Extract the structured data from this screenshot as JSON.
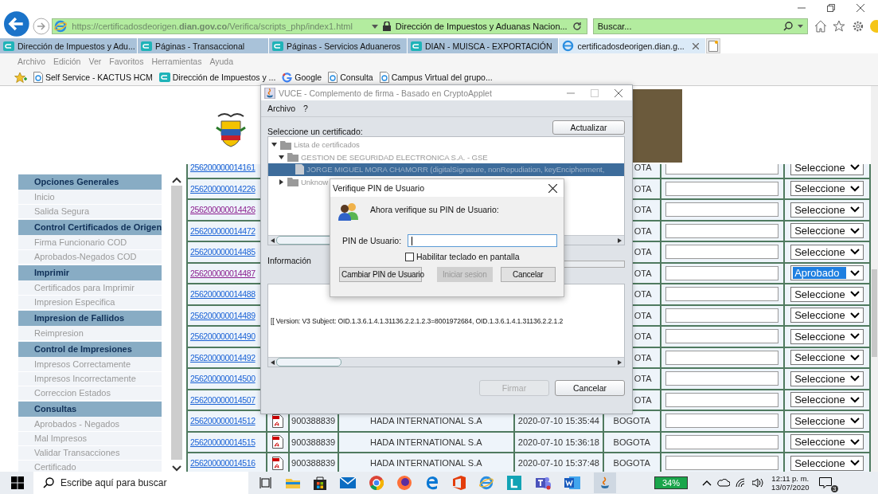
{
  "browser": {
    "url": "https://certificadosdeorigen.**dian.gov.co**/Verifica/scripts_php/index1.html",
    "site_title": "Dirección de Impuestos y Aduanas Nacion...",
    "search_placeholder": "Buscar...",
    "tabs": [
      {
        "label": "Dirección de Impuestos y Adu...",
        "selected": false
      },
      {
        "label": "Páginas - Transaccional",
        "selected": false
      },
      {
        "label": "Páginas - Servicios Aduaneros",
        "selected": false
      },
      {
        "label": "DIAN - MUISCA - EXPORTACIÓN",
        "selected": false
      },
      {
        "label": "certificadosdeorigen.dian.g...",
        "selected": true
      }
    ],
    "menu": [
      "Archivo",
      "Edición",
      "Ver",
      "Favoritos",
      "Herramientas",
      "Ayuda"
    ],
    "favorites": [
      {
        "label": "Self Service - KACTUS HCM",
        "kind": "page"
      },
      {
        "label": "Dirección de Impuestos y ...",
        "kind": "site"
      },
      {
        "label": "Google",
        "kind": "google"
      },
      {
        "label": "Consulta",
        "kind": "page"
      },
      {
        "label": "Campus Virtual del grupo...",
        "kind": "page"
      }
    ]
  },
  "sidebar": [
    {
      "title": "Opciones Generales",
      "items": [
        "Inicio",
        "Salida Segura"
      ]
    },
    {
      "title": "Control Certificados de Origen",
      "items": [
        "Firma Funcionario COD",
        "Aprobados-Negados COD"
      ]
    },
    {
      "title": "Imprimir",
      "items": [
        "Certificados para Imprimir",
        "Impresion Especifica"
      ]
    },
    {
      "title": "Impresion de Fallidos",
      "items": [
        "Reimpresion"
      ]
    },
    {
      "title": "Control de Impresiones",
      "items": [
        "Impresos Correctamente",
        "Impresos Incorrectamente",
        "Correccion Estados"
      ]
    },
    {
      "title": "Consultas",
      "items": [
        "Aprobados - Negados",
        "Mal Impresos",
        "Validar Transacciones",
        "Certificado"
      ]
    }
  ],
  "rows": [
    {
      "kind": "covered",
      "number": "256200000014161",
      "visited": false,
      "city": "OTA",
      "status": "Seleccione",
      "highlighted": false
    },
    {
      "kind": "covered",
      "number": "256200000014226",
      "visited": false,
      "city": "OTA",
      "status": "Seleccione",
      "highlighted": false
    },
    {
      "kind": "covered",
      "number": "256200000014426",
      "visited": true,
      "city": "OTA",
      "status": "Seleccione",
      "highlighted": false
    },
    {
      "kind": "covered",
      "number": "256200000014472",
      "visited": false,
      "city": "OTA",
      "status": "Seleccione",
      "highlighted": false
    },
    {
      "kind": "covered",
      "number": "256200000014485",
      "visited": false,
      "city": "OTA",
      "status": "Seleccione",
      "highlighted": false
    },
    {
      "kind": "covered",
      "number": "256200000014487",
      "visited": true,
      "city": "OTA",
      "status": "Aprobado",
      "highlighted": true
    },
    {
      "kind": "covered",
      "number": "256200000014488",
      "visited": false,
      "city": "OTA",
      "status": "Seleccione",
      "highlighted": false
    },
    {
      "kind": "covered",
      "number": "256200000014489",
      "visited": false,
      "city": "OTA",
      "status": "Seleccione",
      "highlighted": false
    },
    {
      "kind": "covered",
      "number": "256200000014490",
      "visited": false,
      "city": "OTA",
      "status": "Seleccione",
      "highlighted": false
    },
    {
      "kind": "covered",
      "number": "256200000014492",
      "visited": false,
      "city": "OTA",
      "status": "Seleccione",
      "highlighted": false
    },
    {
      "kind": "covered",
      "number": "256200000014500",
      "visited": false,
      "city": "OTA",
      "status": "Seleccione",
      "highlighted": false
    },
    {
      "kind": "covered",
      "number": "256200000014507",
      "visited": false,
      "city": "OTA",
      "status": "Seleccione",
      "highlighted": false
    },
    {
      "kind": "full",
      "number": "256200000014512",
      "visited": false,
      "nit": "900388839",
      "company": "HADA INTERNATIONAL S.A",
      "date": "2020-07-10 15:35:44",
      "city": "BOGOTA",
      "status": "Seleccione",
      "highlighted": false
    },
    {
      "kind": "full",
      "number": "256200000014515",
      "visited": false,
      "nit": "900388839",
      "company": "HADA INTERNATIONAL S.A",
      "date": "2020-07-10 15:36:18",
      "city": "BOGOTA",
      "status": "Seleccione",
      "highlighted": false
    },
    {
      "kind": "full",
      "number": "256200000014516",
      "visited": false,
      "nit": "900388839",
      "company": "HADA INTERNATIONAL S.A",
      "date": "2020-07-10 15:37:48",
      "city": "BOGOTA",
      "status": "Seleccione",
      "highlighted": false
    }
  ],
  "sign_window": {
    "title": "VUCE - Complemento de firma - Basado en CryptoApplet",
    "menu": [
      "Archivo",
      "?"
    ],
    "prompt": "Seleccione un certificado:",
    "refresh_button": "Actualizar",
    "tree": [
      {
        "label": "Lista de certificados",
        "expanded": true,
        "selected": false,
        "children": [
          {
            "label": "GESTION DE SEGURIDAD ELECTRONICA S.A. - GSE",
            "expanded": true,
            "selected": false,
            "children": [
              {
                "label": "JORGE MIGUEL MORA CHAMORR (digitalSignature, nonRepudiation, keyEncipherment,",
                "selected": true
              }
            ]
          },
          {
            "label": "Unknow",
            "expanded": false,
            "selected": false
          }
        ]
      }
    ],
    "info_label": "Información",
    "progress": {
      "level": 0
    },
    "info_text": "[[  Version: V3   Subject: OID.1.3.6.1.4.1.31136.2.2.1.2.3=8001972684, OID.1.3.6.1.4.1.31136.2.2.1.2",
    "buttons": [
      {
        "label": "Firmar",
        "disabled": true
      },
      {
        "label": "Cancelar",
        "disabled": false
      }
    ]
  },
  "pin_dialog": {
    "title": "Verifique PIN de Usuario",
    "message": "Ahora verifique su PIN de Usuario:",
    "pin_label": "PIN de Usuario:",
    "focused": true,
    "checkbox": {
      "label": "Habilitar teclado en pantalla",
      "checked": false
    },
    "buttons": [
      {
        "label": "Cambiar PIN de Usuario",
        "disabled": false
      },
      {
        "label": "Iniciar sesion",
        "disabled": true
      },
      {
        "label": "Cancelar",
        "disabled": false
      }
    ]
  },
  "taskbar": {
    "search_placeholder": "Escribe aquí para buscar",
    "battery": "34%",
    "time": "12:11 p. m.",
    "date": "13/07/2020",
    "notifications": "3"
  }
}
